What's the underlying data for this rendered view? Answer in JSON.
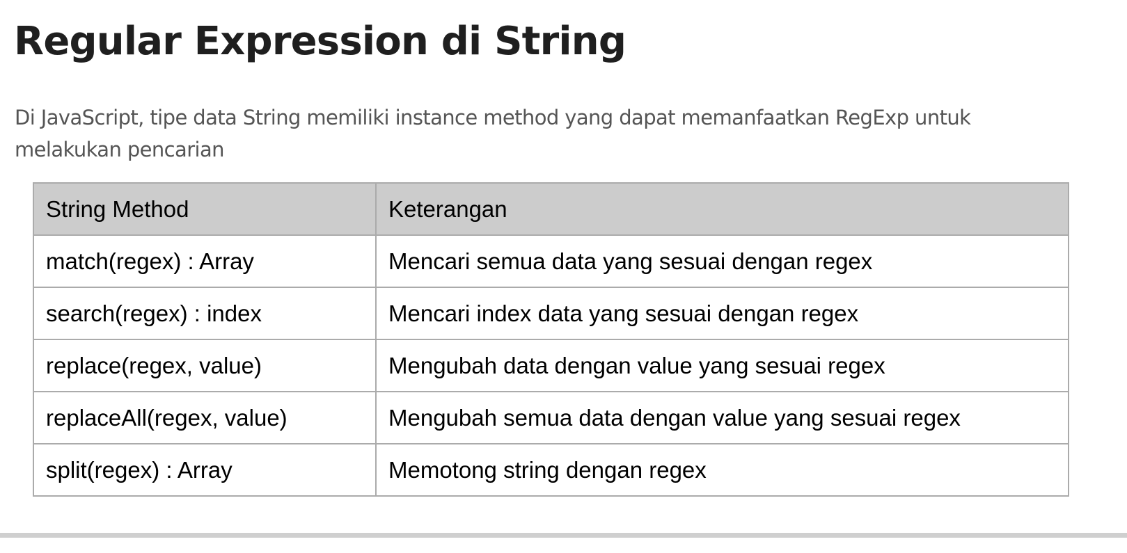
{
  "heading": "Regular Expression di String",
  "intro": "Di JavaScript, tipe data String memiliki instance method yang dapat memanfaatkan RegExp untuk melakukan pencarian",
  "table": {
    "headers": [
      "String Method",
      "Keterangan"
    ],
    "rows": [
      [
        "match(regex) : Array",
        "Mencari semua data yang sesuai dengan regex"
      ],
      [
        "search(regex) : index",
        "Mencari index data yang sesuai dengan regex"
      ],
      [
        "replace(regex, value)",
        "Mengubah data dengan value yang sesuai regex"
      ],
      [
        "replaceAll(regex, value)",
        "Mengubah semua data dengan value yang sesuai regex"
      ],
      [
        "split(regex) : Array",
        "Memotong string dengan regex"
      ]
    ]
  },
  "colors": {
    "heading": "#1f1f1f",
    "body_text": "#555555",
    "table_header_bg": "#cccccc",
    "table_border": "#ababab"
  }
}
